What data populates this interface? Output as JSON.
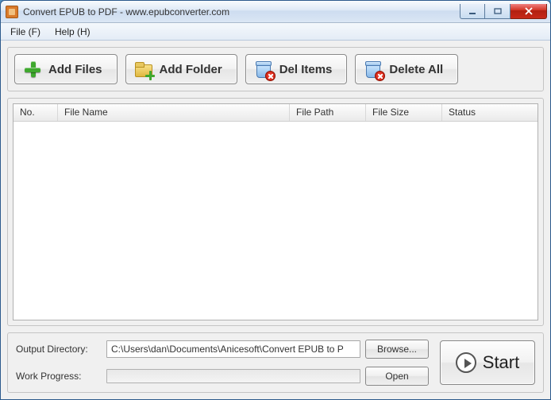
{
  "window": {
    "title": "Convert EPUB to PDF - www.epubconverter.com"
  },
  "menu": {
    "file": "File (F)",
    "help": "Help (H)"
  },
  "toolbar": {
    "add_files": "Add Files",
    "add_folder": "Add Folder",
    "del_items": "Del Items",
    "delete_all": "Delete All"
  },
  "columns": {
    "no": "No.",
    "file_name": "File Name",
    "file_path": "File Path",
    "file_size": "File Size",
    "status": "Status"
  },
  "rows": [],
  "output": {
    "dir_label": "Output Directory:",
    "dir_value": "C:\\Users\\dan\\Documents\\Anicesoft\\Convert EPUB to P",
    "browse": "Browse...",
    "progress_label": "Work Progress:",
    "open": "Open"
  },
  "start": "Start"
}
